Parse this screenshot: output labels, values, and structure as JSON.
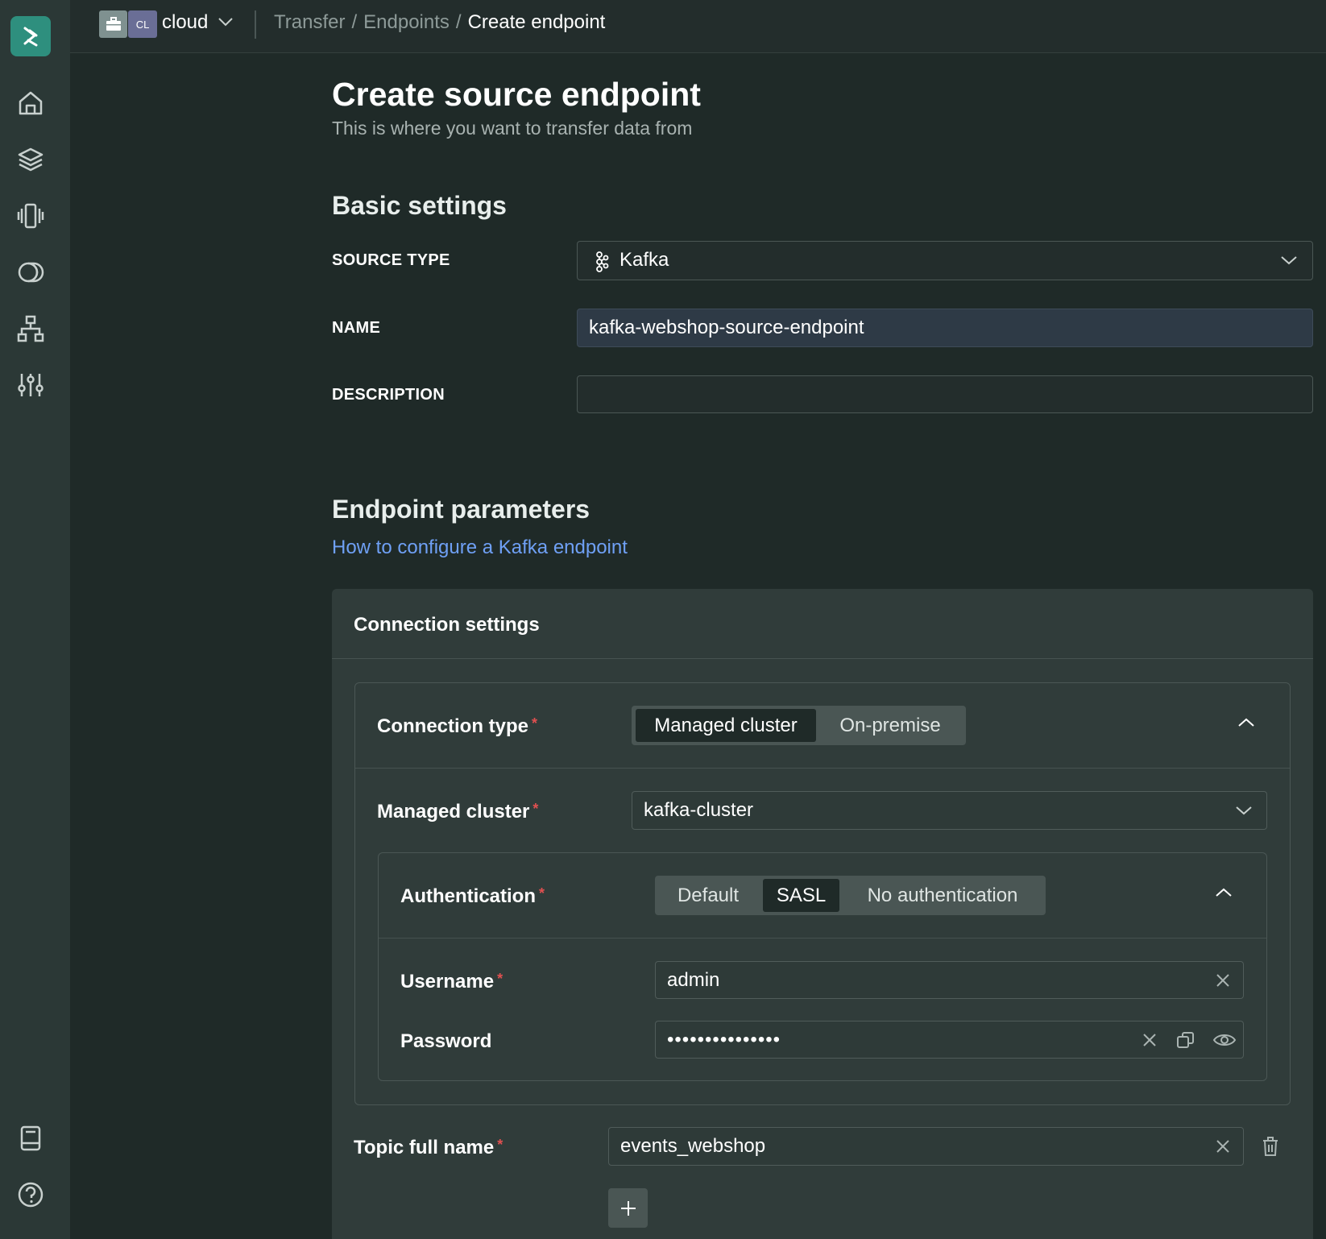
{
  "topbar": {
    "org_badge": "CL",
    "org_name": "cloud",
    "breadcrumbs": [
      "Transfer",
      "Endpoints",
      "Create endpoint"
    ],
    "separator": "/"
  },
  "sidebar": {
    "icons": [
      "logo-icon",
      "home-icon",
      "layers-icon",
      "services-icon",
      "toggle-icon",
      "hierarchy-icon",
      "sliders-icon",
      "docs-icon",
      "help-icon"
    ]
  },
  "page": {
    "title": "Create source endpoint",
    "subtitle": "This is where you want to transfer data from"
  },
  "basic": {
    "heading": "Basic settings",
    "source_type_label": "SOURCE TYPE",
    "source_type_value": "Kafka",
    "name_label": "NAME",
    "name_value": "kafka-webshop-source-endpoint",
    "description_label": "DESCRIPTION",
    "description_value": ""
  },
  "endpoint": {
    "heading": "Endpoint parameters",
    "help_link": "How to configure a Kafka endpoint",
    "connection_settings": "Connection settings",
    "connection_type_label": "Connection type",
    "connection_type_options": [
      "Managed cluster",
      "On-premise"
    ],
    "connection_type_selected": "Managed cluster",
    "managed_cluster_label": "Managed cluster",
    "managed_cluster_value": "kafka-cluster",
    "auth_label": "Authentication",
    "auth_options": [
      "Default",
      "SASL",
      "No authentication"
    ],
    "auth_selected": "SASL",
    "username_label": "Username",
    "username_value": "admin",
    "password_label": "Password",
    "password_value": "•••••••••••••••",
    "topic_label": "Topic full name",
    "topic_value": "events_webshop",
    "required_mark": "*"
  },
  "colors": {
    "background": "#1f2a28",
    "sidebar": "#2b3836",
    "accent": "#2e8f7e",
    "link": "#6fa0f5",
    "required": "#e05050"
  }
}
